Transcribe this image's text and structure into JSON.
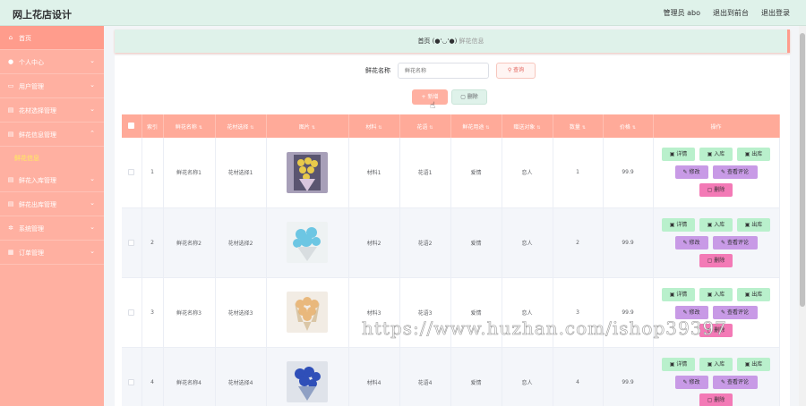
{
  "header": {
    "title": "网上花店设计",
    "links": [
      "管理员 abo",
      "退出到前台",
      "退出登录"
    ]
  },
  "sidebar": {
    "items": [
      {
        "label": "首页",
        "icon": "home-icon",
        "chevron": false
      },
      {
        "label": "个人中心",
        "icon": "user-icon",
        "chevron": true
      },
      {
        "label": "用户管理",
        "icon": "users-icon",
        "chevron": true
      },
      {
        "label": "花材选择管理",
        "icon": "list-icon",
        "chevron": true
      },
      {
        "label": "鲜花信息管理",
        "icon": "list-icon",
        "chevron": true,
        "submenu": "鲜花信息"
      },
      {
        "label": "鲜花入库管理",
        "icon": "list-icon",
        "chevron": true
      },
      {
        "label": "鲜花出库管理",
        "icon": "list-icon",
        "chevron": true
      },
      {
        "label": "系统管理",
        "icon": "gear-icon",
        "chevron": true
      },
      {
        "label": "订单管理",
        "icon": "order-icon",
        "chevron": true
      }
    ]
  },
  "breadcrumb": {
    "home": "首页",
    "face": "(●'◡'●)",
    "current": "鲜花信息"
  },
  "search": {
    "label": "鲜花名称",
    "placeholder": "鲜花名称",
    "button": "查询"
  },
  "actions": {
    "add": "新增",
    "delete": "删除"
  },
  "table": {
    "columns": [
      "索引",
      "鲜花名称",
      "花材选择",
      "图片",
      "材料",
      "花语",
      "鲜花用途",
      "赠送对象",
      "数量",
      "价格",
      "操作"
    ],
    "rows": [
      {
        "index": "1",
        "name": "鲜花名称1",
        "material_choice": "花材选择1",
        "material": "材料1",
        "language": "花语1",
        "usage": "爱情",
        "target": "恋人",
        "qty": "1",
        "price": "99.9"
      },
      {
        "index": "2",
        "name": "鲜花名称2",
        "material_choice": "花材选择2",
        "material": "材料2",
        "language": "花语2",
        "usage": "爱情",
        "target": "恋人",
        "qty": "2",
        "price": "99.9"
      },
      {
        "index": "3",
        "name": "鲜花名称3",
        "material_choice": "花材选择3",
        "material": "材料3",
        "language": "花语3",
        "usage": "爱情",
        "target": "恋人",
        "qty": "3",
        "price": "99.9"
      },
      {
        "index": "4",
        "name": "鲜花名称4",
        "material_choice": "花材选择4",
        "material": "材料4",
        "language": "花语4",
        "usage": "爱情",
        "target": "恋人",
        "qty": "4",
        "price": "99.9"
      }
    ],
    "ops": {
      "detail": "详情",
      "in": "入库",
      "out": "出库",
      "edit": "修改",
      "review": "查看评论",
      "delete": "删除"
    }
  },
  "watermark": "https://www.huzhan.com/ishop39397",
  "colors": {
    "header_bg": "#dff2ea",
    "sidebar_bg": "#ffb0a1",
    "table_header": "#ffaa99",
    "btn_green": "#b9f0cc",
    "btn_purple": "#c89ae6",
    "btn_pink": "#f37ab6"
  }
}
